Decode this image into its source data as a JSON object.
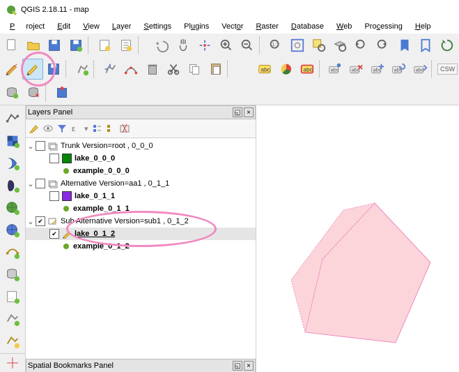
{
  "title": "QGIS 2.18.11 - map",
  "menu": [
    "Project",
    "Edit",
    "View",
    "Layer",
    "Settings",
    "Plugins",
    "Vector",
    "Raster",
    "Database",
    "Web",
    "Processing",
    "Help"
  ],
  "panels": {
    "layers": {
      "title": "Layers Panel"
    },
    "bookmarks": {
      "title": "Spatial Bookmarks Panel"
    }
  },
  "tree": {
    "g0": {
      "label": "Trunk Version=root , 0_0_0"
    },
    "g0_l0": {
      "label": "lake_0_0_0",
      "fill": "#008800"
    },
    "g0_l1": {
      "label": "example_0_0_0",
      "fill": "#6aa824"
    },
    "g1": {
      "label": "Alternative Version=aa1 , 0_1_1"
    },
    "g1_l0": {
      "label": "lake_0_1_1",
      "fill": "#8a2be2"
    },
    "g1_l1": {
      "label": "example_0_1_1",
      "fill": "#6aa824"
    },
    "g2": {
      "label": "Sub Alternative Version=sub1 , 0_1_2"
    },
    "g2_l0": {
      "label": "lake_0_1_2"
    },
    "g2_l1": {
      "label": "example_0_1_2",
      "fill": "#6aa824"
    }
  },
  "csw": "CSW"
}
